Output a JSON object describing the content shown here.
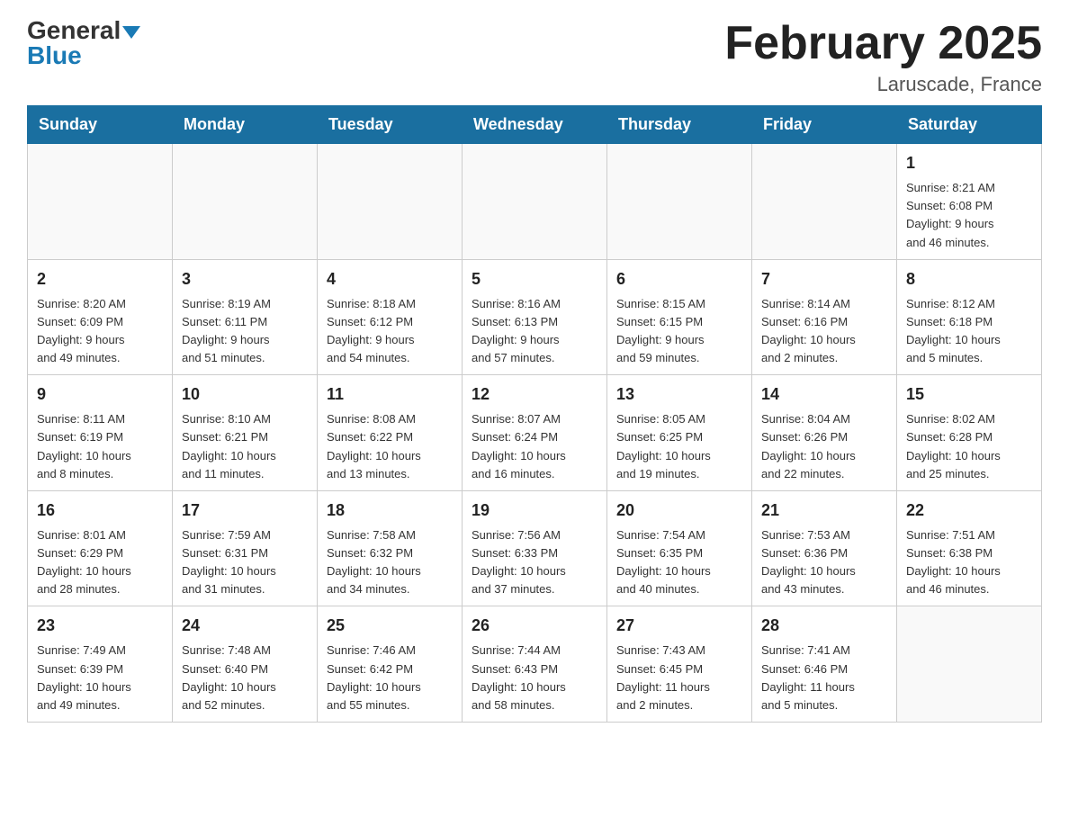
{
  "header": {
    "logo": {
      "general": "General",
      "blue": "Blue"
    },
    "title": "February 2025",
    "location": "Laruscade, France"
  },
  "weekdays": [
    "Sunday",
    "Monday",
    "Tuesday",
    "Wednesday",
    "Thursday",
    "Friday",
    "Saturday"
  ],
  "weeks": [
    [
      {
        "day": "",
        "info": ""
      },
      {
        "day": "",
        "info": ""
      },
      {
        "day": "",
        "info": ""
      },
      {
        "day": "",
        "info": ""
      },
      {
        "day": "",
        "info": ""
      },
      {
        "day": "",
        "info": ""
      },
      {
        "day": "1",
        "info": "Sunrise: 8:21 AM\nSunset: 6:08 PM\nDaylight: 9 hours\nand 46 minutes."
      }
    ],
    [
      {
        "day": "2",
        "info": "Sunrise: 8:20 AM\nSunset: 6:09 PM\nDaylight: 9 hours\nand 49 minutes."
      },
      {
        "day": "3",
        "info": "Sunrise: 8:19 AM\nSunset: 6:11 PM\nDaylight: 9 hours\nand 51 minutes."
      },
      {
        "day": "4",
        "info": "Sunrise: 8:18 AM\nSunset: 6:12 PM\nDaylight: 9 hours\nand 54 minutes."
      },
      {
        "day": "5",
        "info": "Sunrise: 8:16 AM\nSunset: 6:13 PM\nDaylight: 9 hours\nand 57 minutes."
      },
      {
        "day": "6",
        "info": "Sunrise: 8:15 AM\nSunset: 6:15 PM\nDaylight: 9 hours\nand 59 minutes."
      },
      {
        "day": "7",
        "info": "Sunrise: 8:14 AM\nSunset: 6:16 PM\nDaylight: 10 hours\nand 2 minutes."
      },
      {
        "day": "8",
        "info": "Sunrise: 8:12 AM\nSunset: 6:18 PM\nDaylight: 10 hours\nand 5 minutes."
      }
    ],
    [
      {
        "day": "9",
        "info": "Sunrise: 8:11 AM\nSunset: 6:19 PM\nDaylight: 10 hours\nand 8 minutes."
      },
      {
        "day": "10",
        "info": "Sunrise: 8:10 AM\nSunset: 6:21 PM\nDaylight: 10 hours\nand 11 minutes."
      },
      {
        "day": "11",
        "info": "Sunrise: 8:08 AM\nSunset: 6:22 PM\nDaylight: 10 hours\nand 13 minutes."
      },
      {
        "day": "12",
        "info": "Sunrise: 8:07 AM\nSunset: 6:24 PM\nDaylight: 10 hours\nand 16 minutes."
      },
      {
        "day": "13",
        "info": "Sunrise: 8:05 AM\nSunset: 6:25 PM\nDaylight: 10 hours\nand 19 minutes."
      },
      {
        "day": "14",
        "info": "Sunrise: 8:04 AM\nSunset: 6:26 PM\nDaylight: 10 hours\nand 22 minutes."
      },
      {
        "day": "15",
        "info": "Sunrise: 8:02 AM\nSunset: 6:28 PM\nDaylight: 10 hours\nand 25 minutes."
      }
    ],
    [
      {
        "day": "16",
        "info": "Sunrise: 8:01 AM\nSunset: 6:29 PM\nDaylight: 10 hours\nand 28 minutes."
      },
      {
        "day": "17",
        "info": "Sunrise: 7:59 AM\nSunset: 6:31 PM\nDaylight: 10 hours\nand 31 minutes."
      },
      {
        "day": "18",
        "info": "Sunrise: 7:58 AM\nSunset: 6:32 PM\nDaylight: 10 hours\nand 34 minutes."
      },
      {
        "day": "19",
        "info": "Sunrise: 7:56 AM\nSunset: 6:33 PM\nDaylight: 10 hours\nand 37 minutes."
      },
      {
        "day": "20",
        "info": "Sunrise: 7:54 AM\nSunset: 6:35 PM\nDaylight: 10 hours\nand 40 minutes."
      },
      {
        "day": "21",
        "info": "Sunrise: 7:53 AM\nSunset: 6:36 PM\nDaylight: 10 hours\nand 43 minutes."
      },
      {
        "day": "22",
        "info": "Sunrise: 7:51 AM\nSunset: 6:38 PM\nDaylight: 10 hours\nand 46 minutes."
      }
    ],
    [
      {
        "day": "23",
        "info": "Sunrise: 7:49 AM\nSunset: 6:39 PM\nDaylight: 10 hours\nand 49 minutes."
      },
      {
        "day": "24",
        "info": "Sunrise: 7:48 AM\nSunset: 6:40 PM\nDaylight: 10 hours\nand 52 minutes."
      },
      {
        "day": "25",
        "info": "Sunrise: 7:46 AM\nSunset: 6:42 PM\nDaylight: 10 hours\nand 55 minutes."
      },
      {
        "day": "26",
        "info": "Sunrise: 7:44 AM\nSunset: 6:43 PM\nDaylight: 10 hours\nand 58 minutes."
      },
      {
        "day": "27",
        "info": "Sunrise: 7:43 AM\nSunset: 6:45 PM\nDaylight: 11 hours\nand 2 minutes."
      },
      {
        "day": "28",
        "info": "Sunrise: 7:41 AM\nSunset: 6:46 PM\nDaylight: 11 hours\nand 5 minutes."
      },
      {
        "day": "",
        "info": ""
      }
    ]
  ]
}
